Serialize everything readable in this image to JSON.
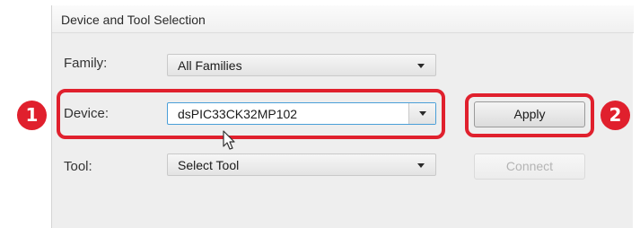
{
  "panel": {
    "title": "Device and Tool Selection"
  },
  "family": {
    "label": "Family:",
    "value": "All Families"
  },
  "device": {
    "label": "Device:",
    "value": "dsPIC33CK32MP102"
  },
  "tool": {
    "label": "Tool:",
    "value": "Select Tool"
  },
  "buttons": {
    "apply": "Apply",
    "connect": "Connect"
  },
  "callouts": {
    "first": "1",
    "second": "2"
  },
  "colors": {
    "highlight": "#e0202d",
    "focus_border": "#4a9fd8"
  },
  "icons": {
    "cursor": "mouse-pointer-icon",
    "dropdown": "chevron-down-icon"
  }
}
